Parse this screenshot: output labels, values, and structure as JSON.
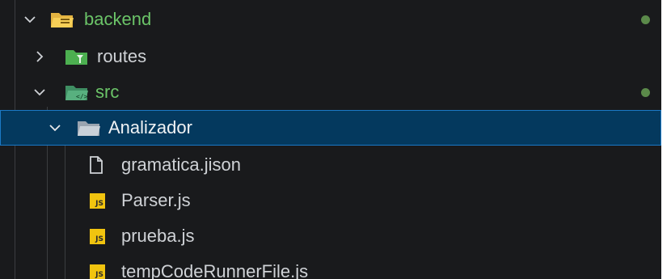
{
  "explorer": {
    "items": [
      {
        "label": "backend",
        "type": "folder",
        "expanded": true,
        "level": 0,
        "color": "#6bc468",
        "modified_dot": true,
        "icon": "folder-open-icon"
      },
      {
        "label": "routes",
        "type": "folder",
        "expanded": false,
        "level": 1,
        "icon": "folder-routes-icon"
      },
      {
        "label": "src",
        "type": "folder",
        "expanded": true,
        "level": 1,
        "color": "#6bc468",
        "modified_dot": true,
        "icon": "folder-src-icon"
      },
      {
        "label": "Analizador",
        "type": "folder",
        "expanded": true,
        "level": 2,
        "selected": true,
        "icon": "folder-open-icon"
      },
      {
        "label": "gramatica.jison",
        "type": "file",
        "level": 3,
        "icon": "file-icon"
      },
      {
        "label": "Parser.js",
        "type": "file",
        "level": 3,
        "icon": "js-file-icon",
        "badge": "JS"
      },
      {
        "label": "prueba.js",
        "type": "file",
        "level": 3,
        "icon": "js-file-icon",
        "badge": "JS"
      },
      {
        "label": "tempCodeRunnerFile.js",
        "type": "file",
        "level": 3,
        "icon": "js-file-icon",
        "badge": "JS"
      }
    ]
  },
  "colors": {
    "background": "#191a1c",
    "selected_background": "#04395e",
    "selected_border": "#1b79c6",
    "git_modified_green": "#6bc468",
    "dot_color": "#5b8a4a"
  }
}
